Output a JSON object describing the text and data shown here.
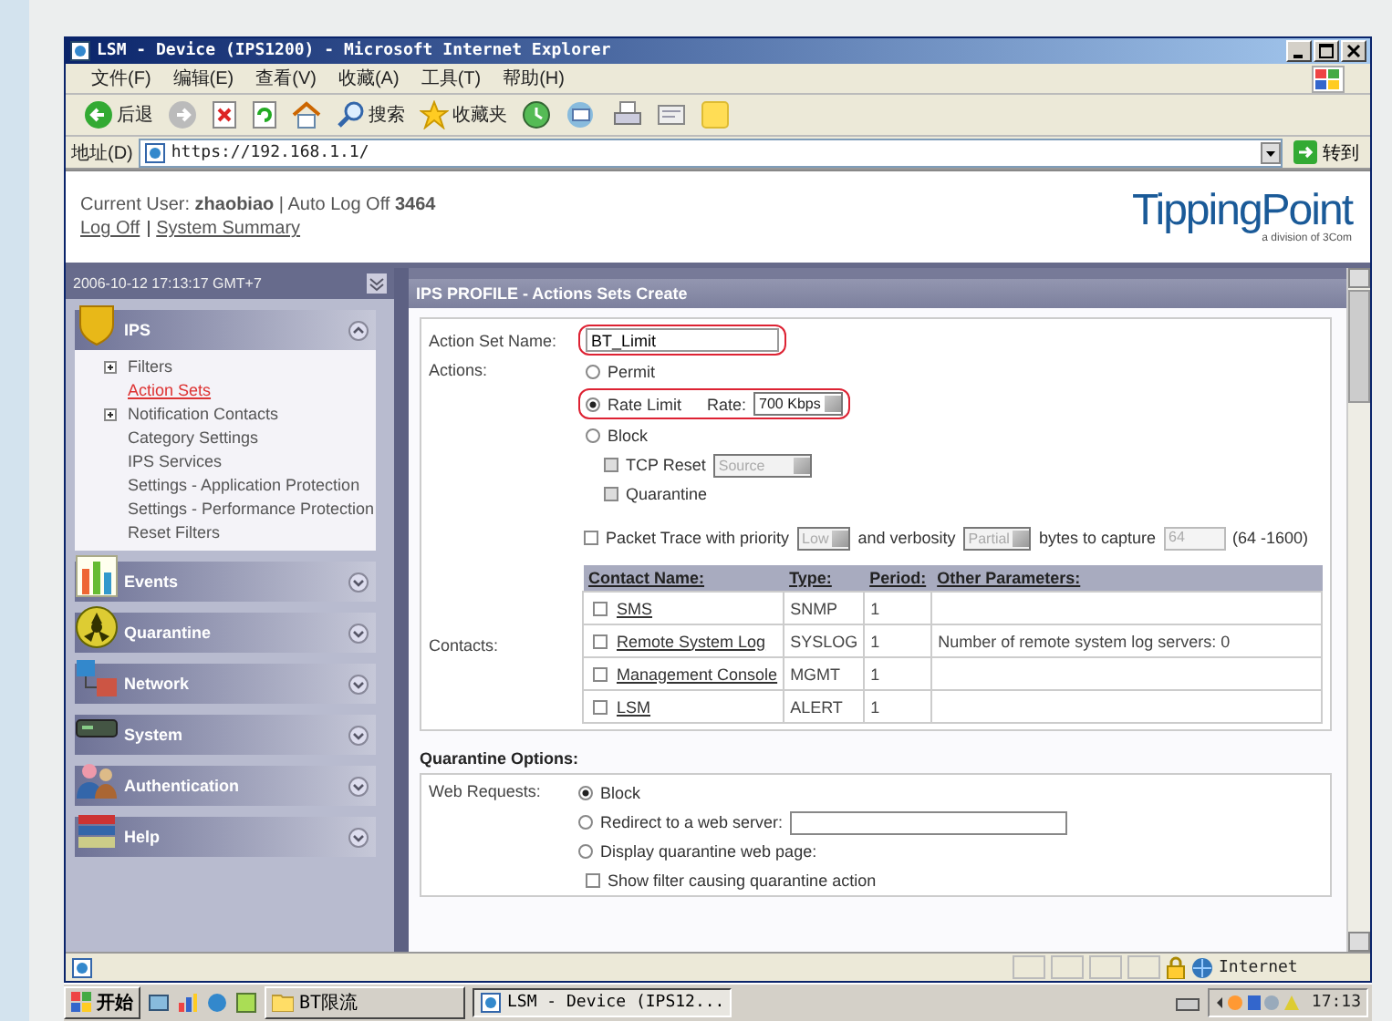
{
  "window": {
    "title": "LSM - Device (IPS1200) - Microsoft Internet Explorer"
  },
  "menu": [
    "文件(F)",
    "编辑(E)",
    "查看(V)",
    "收藏(A)",
    "工具(T)",
    "帮助(H)"
  ],
  "toolbar": [
    {
      "kind": "back",
      "label": "后退"
    },
    {
      "kind": "forward"
    },
    {
      "kind": "stop"
    },
    {
      "kind": "refresh"
    },
    {
      "kind": "home"
    },
    {
      "kind": "search",
      "label": "搜索"
    },
    {
      "kind": "favorites",
      "label": "收藏夹"
    },
    {
      "kind": "history"
    },
    {
      "kind": "mail"
    },
    {
      "kind": "print"
    },
    {
      "kind": "edit"
    },
    {
      "kind": "note"
    }
  ],
  "address": {
    "label": "地址(D)",
    "value": "https://192.168.1.1/",
    "go": "转到"
  },
  "header": {
    "user_line": "Current User: **zhaobiao** | Auto Log Off **3464**",
    "links": [
      "Log Off",
      "System Summary"
    ],
    "logo": "TippingPoint",
    "logo_sub": "a division of 3Com"
  },
  "sidebar": {
    "timestamp": "2006-10-12 17:13:17 GMT+7",
    "sections": [
      {
        "kind": "ips",
        "label": "IPS",
        "expanded": true,
        "items": [
          {
            "label": "Filters",
            "expandable": true,
            "selected": false
          },
          {
            "label": "Action Sets",
            "expandable": false,
            "selected": true
          },
          {
            "label": "Notification Contacts",
            "expandable": true,
            "selected": false
          },
          {
            "label": "Category Settings",
            "expandable": false,
            "selected": false
          },
          {
            "label": "IPS Services",
            "expandable": false,
            "selected": false
          },
          {
            "label": "Settings - Application Protection",
            "expandable": false,
            "selected": false
          },
          {
            "label": "Settings - Performance Protection",
            "expandable": false,
            "selected": false
          },
          {
            "label": "Reset Filters",
            "expandable": false,
            "selected": false
          }
        ]
      },
      {
        "kind": "events",
        "label": "Events",
        "expanded": false
      },
      {
        "kind": "quarantine",
        "label": "Quarantine",
        "expanded": false
      },
      {
        "kind": "network",
        "label": "Network",
        "expanded": false
      },
      {
        "kind": "system",
        "label": "System",
        "expanded": false
      },
      {
        "kind": "authentication",
        "label": "Authentication",
        "expanded": false
      },
      {
        "kind": "help",
        "label": "Help",
        "expanded": false
      }
    ]
  },
  "panel": {
    "title": "IPS PROFILE - Actions Sets Create",
    "name_field": {
      "label": "Action Set Name:",
      "value": "BT_Limit",
      "highlighted": true
    },
    "actions": {
      "label": "Actions:",
      "options": [
        {
          "label": "Permit",
          "selected": false,
          "highlighted": false
        },
        {
          "label": "Rate Limit",
          "selected": true,
          "highlighted": true,
          "rate_label": "Rate:",
          "rate": "700 Kbps"
        },
        {
          "label": "Block",
          "selected": false,
          "highlighted": false
        }
      ],
      "block_options": [
        {
          "label": "TCP Reset",
          "checked": false,
          "disabled": true,
          "select": "Source"
        },
        {
          "label": "Quarantine",
          "checked": false,
          "disabled": true
        }
      ],
      "packet_trace": {
        "checked": false,
        "label": "Packet Trace with priority",
        "priority": "Low",
        "verbosity_label": "and verbosity",
        "verbosity": "Partial",
        "bytes_label": "bytes to capture",
        "bytes": "64",
        "range": "(64 -1600)"
      }
    },
    "contacts": {
      "label": "Contacts:",
      "columns": [
        "Contact Name:",
        "Type:",
        "Period:",
        "Other Parameters:"
      ],
      "rows": [
        {
          "checked": false,
          "name": "SMS",
          "type": "SNMP",
          "period": "1"
        },
        {
          "checked": false,
          "name": "Remote System Log",
          "type": "SYSLOG",
          "period": "1",
          "other": "Number of remote system log servers: 0"
        },
        {
          "checked": false,
          "name": "Management Console",
          "type": "MGMT",
          "period": "1"
        },
        {
          "checked": false,
          "name": "LSM",
          "type": "ALERT",
          "period": "1"
        }
      ]
    },
    "quarantine": {
      "title": "Quarantine Options:",
      "label": "Web Requests:",
      "options": [
        {
          "kind": "plain",
          "label": "Block",
          "selected": true
        },
        {
          "kind": "url",
          "label": "Redirect to a web server:",
          "selected": false
        },
        {
          "kind": "plain",
          "label": "Display quarantine web page:",
          "selected": false
        }
      ],
      "show_filter": {
        "label": "Show filter causing quarantine action",
        "checked": false
      }
    }
  },
  "status_bar": {
    "zone": "Internet"
  },
  "taskbar": {
    "start": "开始",
    "folder": "BT限流",
    "task": "LSM - Device (IPS12...",
    "time": "17:13"
  }
}
